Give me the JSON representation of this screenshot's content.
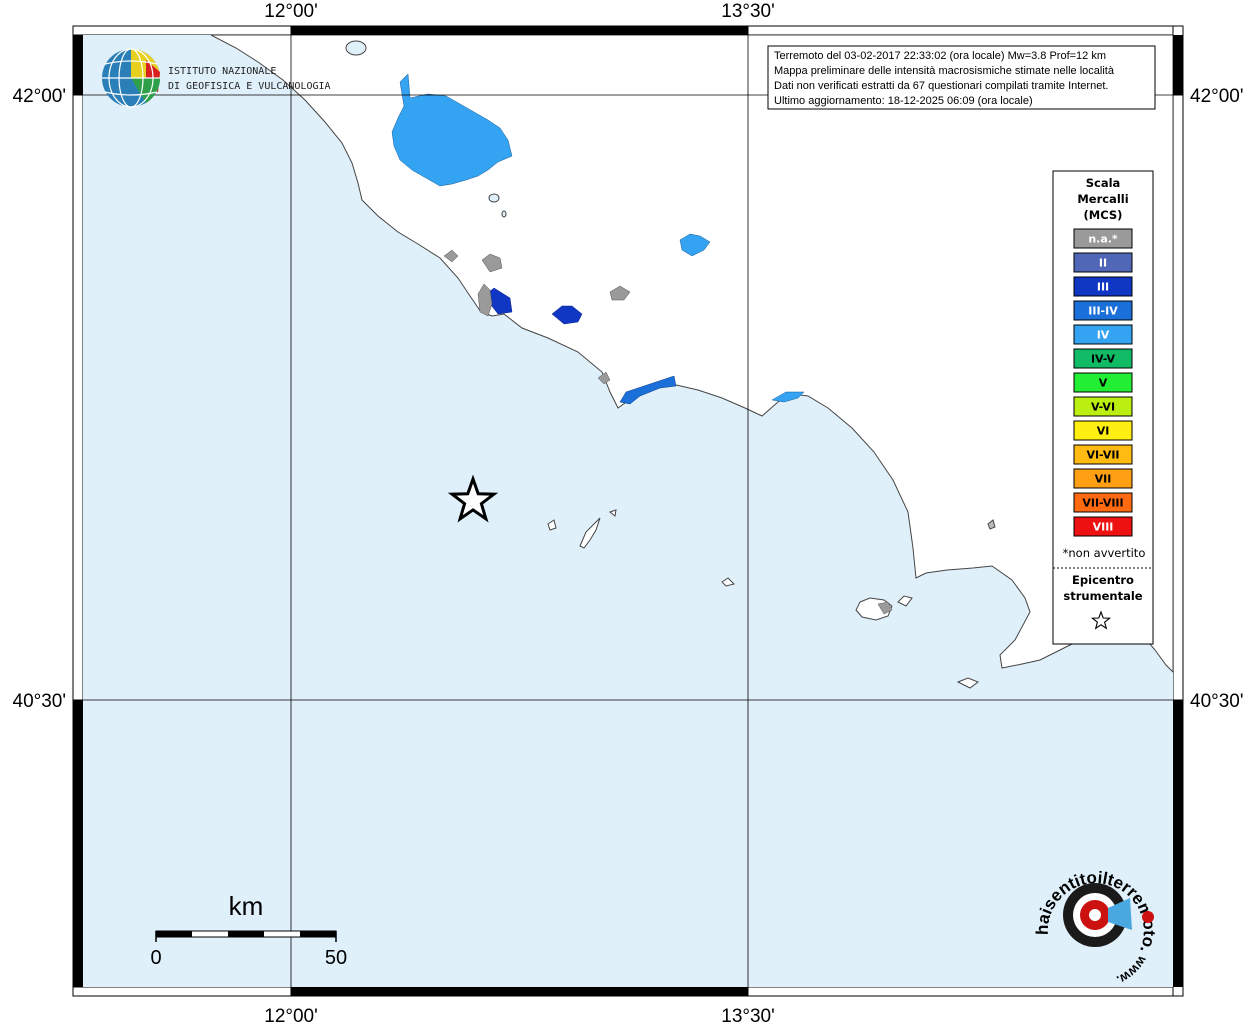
{
  "map": {
    "lon_labels": [
      "12°00'",
      "13°30'"
    ],
    "lat_labels": [
      "42°00'",
      "40°30'"
    ],
    "colors": {
      "sea": "#e0f0fa",
      "land": "#ffffff",
      "coast": "#555555"
    }
  },
  "title_box": {
    "lines": [
      "Terremoto del 03-02-2017 22:33:02 (ora locale) Mw=3.8 Prof=12 km",
      "Mappa preliminare delle intensità macrosismiche stimate nelle località",
      "Dati non verificati estratti da 67 questionari compilati tramite Internet.",
      "Ultimo aggiornamento: 18-12-2025 06:09 (ora locale)"
    ]
  },
  "ingv_logo": {
    "icon": "globe-logo-icon",
    "line1": "ISTITUTO NAZIONALE",
    "line2": "DI GEOFISICA E VULCANOLOGIA"
  },
  "legend": {
    "title": [
      "Scala",
      "Mercalli",
      "(MCS)"
    ],
    "items": [
      {
        "label": "n.a.*",
        "color": "#9a9a9a",
        "text_color": "#ffffff"
      },
      {
        "label": "II",
        "color": "#5067b8",
        "text_color": "#ffffff"
      },
      {
        "label": "III",
        "color": "#1036c4",
        "text_color": "#ffffff"
      },
      {
        "label": "III-IV",
        "color": "#1a6fd8",
        "text_color": "#ffffff"
      },
      {
        "label": "IV",
        "color": "#33a3f2",
        "text_color": "#ffffff"
      },
      {
        "label": "IV-V",
        "color": "#11bb66",
        "text_color": "#000000"
      },
      {
        "label": "V",
        "color": "#22ee33",
        "text_color": "#000000"
      },
      {
        "label": "V-VI",
        "color": "#bbee11",
        "text_color": "#000000"
      },
      {
        "label": "VI",
        "color": "#ffee11",
        "text_color": "#000000"
      },
      {
        "label": "VI-VII",
        "color": "#ffbb11",
        "text_color": "#000000"
      },
      {
        "label": "VII",
        "color": "#ffa014",
        "text_color": "#000000"
      },
      {
        "label": "VII-VIII",
        "color": "#ff6a11",
        "text_color": "#000000"
      },
      {
        "label": "VIII",
        "color": "#ee1111",
        "text_color": "#ffffff"
      }
    ],
    "note": "*non avvertito",
    "epicenter_title": [
      "Epicentro",
      "strumentale"
    ],
    "epicenter_icon": "star-icon"
  },
  "scale_bar": {
    "unit": "km",
    "min_label": "0",
    "max_label": "50"
  },
  "hsit_logo": {
    "icon": "target-megaphone-icon",
    "text_main": "haisentitoilterremoto.it",
    "text_sub": "www."
  },
  "epicenter": {
    "icon": "epicenter-star-icon"
  }
}
